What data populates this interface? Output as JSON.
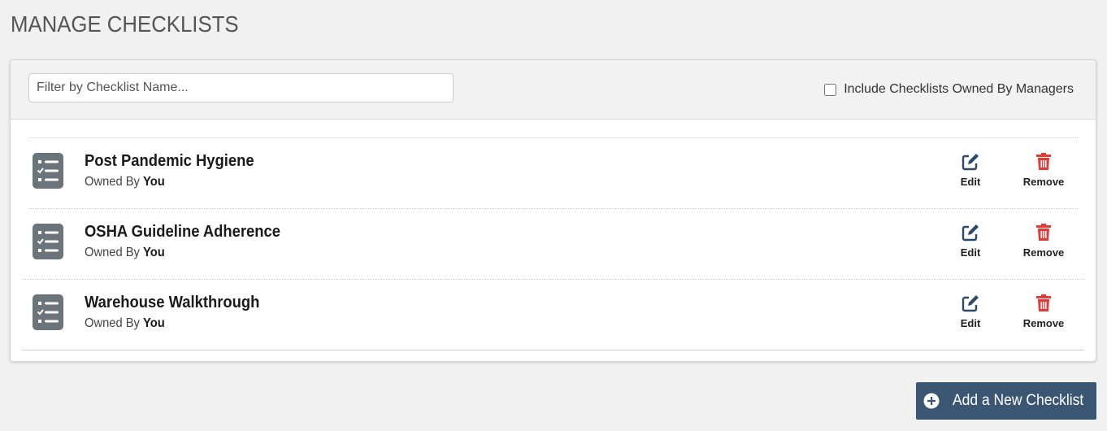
{
  "page": {
    "title": "MANAGE CHECKLISTS"
  },
  "filter": {
    "placeholder": "Filter by Checklist Name...",
    "value": ""
  },
  "include_managers": {
    "label": "Include Checklists Owned By Managers",
    "checked": false
  },
  "checklists": [
    {
      "name": "Post Pandemic Hygiene",
      "owned_prefix": "Owned By",
      "owner": "You",
      "edit_label": "Edit",
      "remove_label": "Remove"
    },
    {
      "name": "OSHA Guideline Adherence",
      "owned_prefix": "Owned By",
      "owner": "You",
      "edit_label": "Edit",
      "remove_label": "Remove"
    },
    {
      "name": "Warehouse Walkthrough",
      "owned_prefix": "Owned By",
      "owner": "You",
      "edit_label": "Edit",
      "remove_label": "Remove"
    }
  ],
  "add_button": {
    "label": "Add a New Checklist",
    "icon": "plus-circle-icon"
  },
  "colors": {
    "background": "#f1f1f1",
    "primary": "#3a5673",
    "edit_icon": "#2d4a66",
    "remove_icon": "#e53935",
    "list_icon": "#6b737b"
  }
}
